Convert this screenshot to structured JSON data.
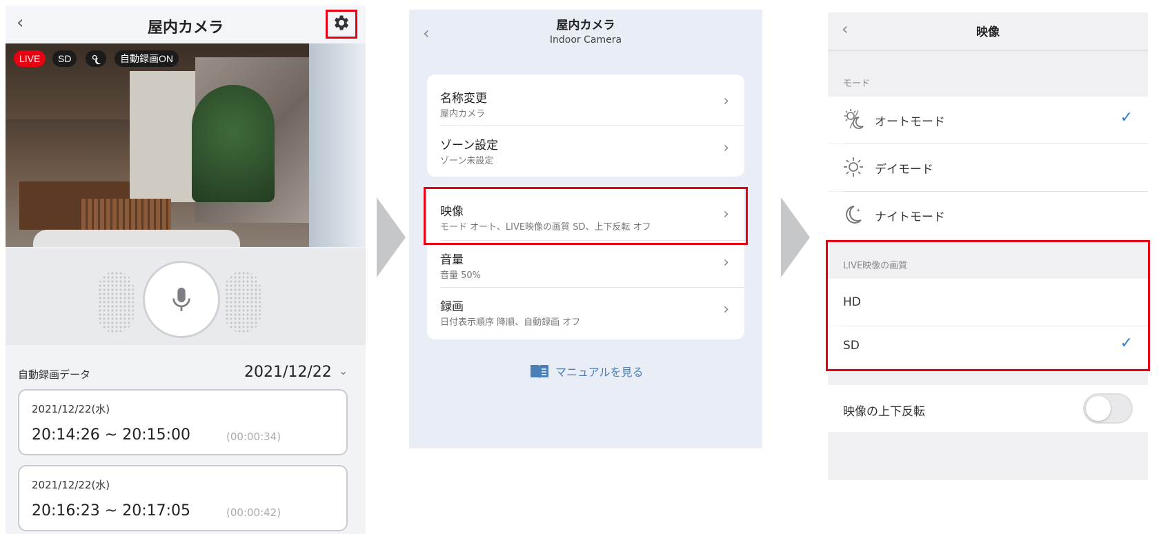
{
  "panel1": {
    "title": "屋内カメラ",
    "badges": {
      "live": "LIVE",
      "sd": "SD",
      "auto_record": "自動録画ON"
    },
    "recording": {
      "label": "自動録画データ",
      "date": "2021/12/22",
      "entries": [
        {
          "date": "2021/12/22(水)",
          "time": "20:14:26 ~ 20:15:00",
          "duration": "(00:00:34)"
        },
        {
          "date": "2021/12/22(水)",
          "time": "20:16:23 ~ 20:17:05",
          "duration": "(00:00:42)"
        }
      ]
    },
    "icons": {
      "back": "chevron-left-icon",
      "settings": "gear-icon",
      "mic": "microphone-icon",
      "dropdown": "chevron-down-icon"
    },
    "highlight_color": "#e60012"
  },
  "panel2": {
    "title": "屋内カメラ",
    "subtitle": "Indoor Camera",
    "group1": [
      {
        "main": "名称変更",
        "sub": "屋内カメラ"
      },
      {
        "main": "ゾーン設定",
        "sub": "ゾーン未設定"
      }
    ],
    "group2": [
      {
        "main": "映像",
        "sub": "モード オート、LIVE映像の画質 SD、上下反転 オフ"
      },
      {
        "main": "音量",
        "sub": "音量 50%"
      },
      {
        "main": "録画",
        "sub": "日付表示順序 降順、自動録画 オフ"
      }
    ],
    "manual_link": "マニュアルを見る",
    "link_color": "#4a7fb8"
  },
  "panel3": {
    "title": "映像",
    "mode_section": "モード",
    "modes": [
      {
        "label": "オートモード",
        "icon": "auto-mode-icon",
        "selected": true
      },
      {
        "label": "デイモード",
        "icon": "sun-icon",
        "selected": false
      },
      {
        "label": "ナイトモード",
        "icon": "moon-icon",
        "selected": false
      }
    ],
    "quality_section": "LIVE映像の画質",
    "qualities": [
      {
        "label": "HD",
        "selected": false
      },
      {
        "label": "SD",
        "selected": true
      }
    ],
    "flip_label": "映像の上下反転",
    "flip_on": false,
    "check_color": "#2f7fd1"
  }
}
